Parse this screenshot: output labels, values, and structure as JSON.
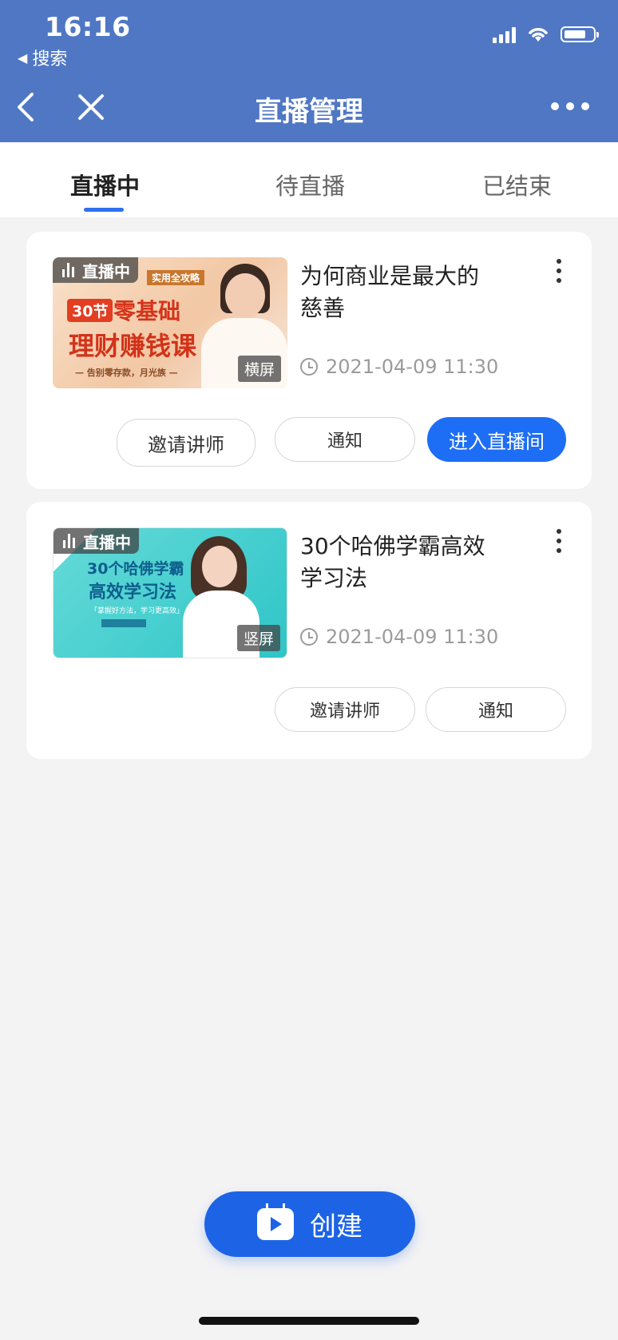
{
  "status_bar": {
    "time": "16:16",
    "back_app": "搜索"
  },
  "nav": {
    "title": "直播管理"
  },
  "tabs": [
    {
      "label": "直播中",
      "active": true
    },
    {
      "label": "待直播",
      "active": false
    },
    {
      "label": "已结束",
      "active": false
    }
  ],
  "cards": [
    {
      "live_tag": "直播中",
      "orientation": "横屏",
      "poster": {
        "top_line": "实用全攻略",
        "badge": "30节",
        "line1": "零基础",
        "line2": "理财赚钱课",
        "line3": "— 告别零存款，月光族 —"
      },
      "title": "为何商业是最大的慈善",
      "time": "2021-04-09 11:30",
      "buttons": {
        "invite": "邀请讲师",
        "notify": "通知",
        "enter": "进入直播间"
      }
    },
    {
      "live_tag": "直播中",
      "orientation": "竖屏",
      "poster": {
        "line1": "30个哈佛学霸",
        "line2": "高效学习法",
        "line3": "「掌握好方法，学习更高效」"
      },
      "title": "30个哈佛学霸高效学习法",
      "time": "2021-04-09 11:30",
      "buttons": {
        "invite": "邀请讲师",
        "notify": "通知"
      }
    }
  ],
  "create_button": "创建",
  "colors": {
    "header": "#4f77c4",
    "accent": "#1d6ef5",
    "background": "#f3f3f4"
  }
}
